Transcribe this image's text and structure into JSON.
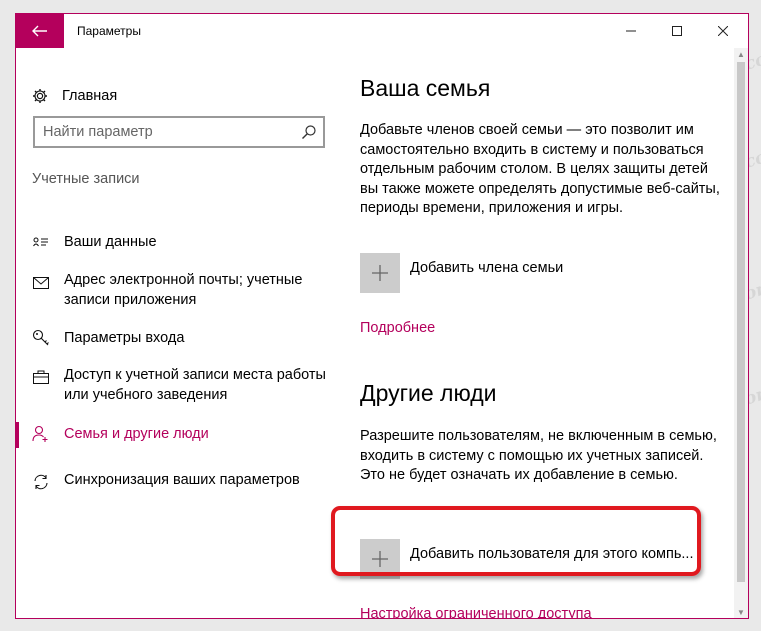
{
  "window": {
    "title": "Параметры"
  },
  "sidebar": {
    "home_label": "Главная",
    "search_placeholder": "Найти параметр",
    "section_title": "Учетные записи",
    "items": [
      {
        "label": "Ваши данные",
        "icon": "person-card-icon"
      },
      {
        "label": "Адрес электронной почты; учетные записи приложения",
        "icon": "mail-icon"
      },
      {
        "label": "Параметры входа",
        "icon": "key-icon"
      },
      {
        "label": "Доступ к учетной записи места работы или учебного заведения",
        "icon": "briefcase-icon"
      },
      {
        "label": "Семья и другие люди",
        "icon": "person-add-icon",
        "active": true
      },
      {
        "label": "Синхронизация ваших параметров",
        "icon": "sync-icon"
      }
    ]
  },
  "main": {
    "family": {
      "heading": "Ваша семья",
      "description": "Добавьте членов своей семьи — это позволит им самостоятельно входить в систему и пользоваться отдельным рабочим столом. В целях защиты детей вы также можете определять допустимые веб-сайты, периоды времени, приложения и игры.",
      "add_label": "Добавить члена семьи",
      "more_link": "Подробнее"
    },
    "others": {
      "heading": "Другие люди",
      "description": "Разрешите пользователям, не включенным в семью, входить в систему с помощью их учетных записей. Это не будет означать их добавление в семью.",
      "add_label": "Добавить пользователя для этого компь...",
      "restricted_link": "Настройка ограниченного доступа"
    }
  },
  "watermark": "Soringpcrepair.com",
  "colors": {
    "accent": "#b4005c",
    "highlight": "#e0191f"
  }
}
